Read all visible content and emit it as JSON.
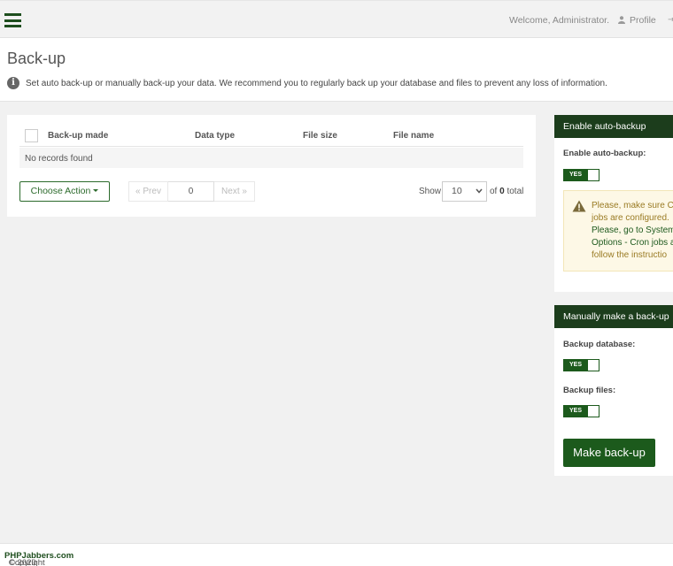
{
  "topbar": {
    "welcome": "Welcome, Administrator.",
    "profile_label": "Profile",
    "accent_color": "#1e4e1e"
  },
  "header": {
    "title": "Back-up",
    "description": "Set auto back-up or manually back-up your data. We recommend you to regularly back up your database and files to prevent any loss of information."
  },
  "table": {
    "columns": [
      "Back-up made",
      "Data type",
      "File size",
      "File name"
    ],
    "empty_message": "No records found"
  },
  "controls": {
    "action_label": "Choose Action",
    "prev_label": "« Prev",
    "next_label": "Next »",
    "page_value": "0",
    "show_label": "Show",
    "per_page_value": "10",
    "per_page_options": [
      "10"
    ],
    "total_prefix": "of",
    "total_count": "0",
    "total_suffix": "total"
  },
  "auto_backup": {
    "heading": "Enable auto-backup",
    "label": "Enable auto-backup:",
    "toggle_state": "YES",
    "warning_lines": [
      "Please, make sure CR",
      "jobs are configured.",
      "Please, go to System",
      "Options - Cron jobs a",
      "follow the instructio"
    ],
    "warning_color": "#9a7b24"
  },
  "manual_backup": {
    "heading": "Manually make a back-up",
    "database_label": "Backup database:",
    "database_toggle": "YES",
    "files_label": "Backup files:",
    "files_toggle": "YES",
    "button_label": "Make back-up",
    "button_color": "#1c5a1c"
  },
  "footer": {
    "prefix": "Copyright",
    "brand": "PHPJabbers.com",
    "suffix": "© 2020"
  }
}
